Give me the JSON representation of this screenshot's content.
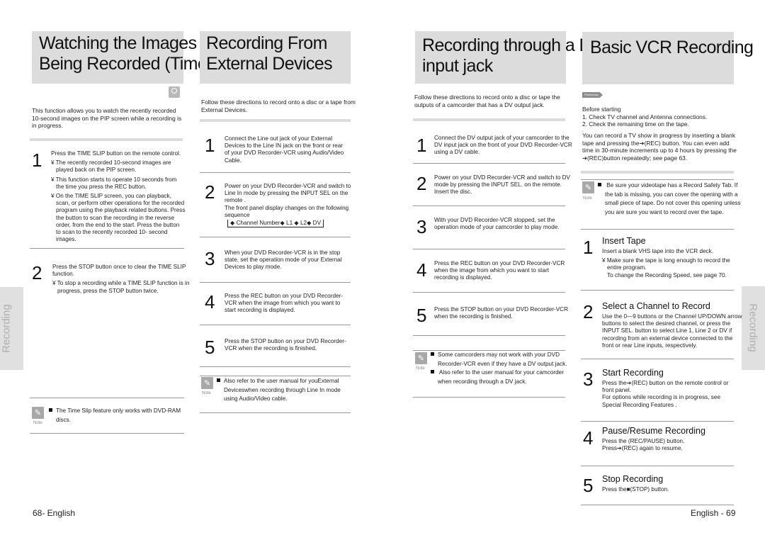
{
  "side_tab_label": "Recording",
  "sections": {
    "timeslip": {
      "title": "Watching the Images\nBeing Recorded (Time Slip)",
      "badge_icon": "dvd-ram-disc-icon",
      "intro": "This function allows you to watch the recently recorded 10-second images on the PIP screen while a recording is in progress.",
      "steps": [
        {
          "num": "1",
          "text": "Press the TIME SLIP button on the remote control.",
          "bullets": [
            "¥ The recently recorded 10-second images are played back on the PIP screen.",
            "¥ This function starts to operate 10 seconds from the time you press the REC button.",
            "¥ On the TIME SLIP screen, you can playback, scan, or perform other operations for the recorded program using the playback related buttons. Press the     button to scan the recording in the reverse order, from the end to the start. Press the     button to scan to the recently recorded  10- second images."
          ]
        },
        {
          "num": "2",
          "text": "Press the STOP button once to clear the TIME SLIP function.",
          "bullets": [
            "¥ To stop a recording while a TIME SLIP function is in progress, press the STOP button twice."
          ]
        }
      ],
      "note_label": "Note",
      "notes": [
        "The Time Slip feature only works with DVD-RAM discs."
      ]
    },
    "external": {
      "title": "Recording From\nExternal Devices",
      "intro": "Follow these directions to record onto a disc or a tape from External Devices.",
      "steps": [
        {
          "num": "1",
          "text": "Connect the Line out jack of your External Devices to the Line IN jack on the front or rear of your DVD Recorder-VCR using Audio/Video Cable."
        },
        {
          "num": "2",
          "text": "Power on your DVD Recorder-VCR and switch to Line In mode by pressing the INPUT SEL on the remote .",
          "text2": "The front panel display changes on the following sequence",
          "sequence": "◆ Channel Number◆  L1 ◆  L2◆  DV"
        },
        {
          "num": "3",
          "text": "When your DVD Recorder-VCR is in the stop state, set the operation mode of your External Devices to play mode."
        },
        {
          "num": "4",
          "text": "Press the REC button on your DVD Recorder-VCR when the image from which you want to start recording is displayed."
        },
        {
          "num": "5",
          "text": "Press the STOP button on your DVD Recorder-VCR when the recording is finished."
        }
      ],
      "note_label": "Note",
      "notes": [
        "Also refer to the user manual for youExternal Deviceswhen recording through Line In mode using Audio/Video cable."
      ]
    },
    "dv": {
      "title": "Recording through a DV\ninput jack",
      "intro": "Follow these directions to record onto a disc or tape the outputs of a camcorder that has a DV output jack.",
      "steps": [
        {
          "num": "1",
          "text": "Connect the DV output jack of your camcorder to the DV input jack on the front of your DVD Recorder-VCR using a DV cable."
        },
        {
          "num": "2",
          "text": "Power on your DVD Recorder-VCR and switch to DV mode by pressing the INPUT SEL. on the remote. Insert the disc."
        },
        {
          "num": "3",
          "text": "With your DVD Recorder-VCR stopped, set the operation mode of your camcorder to play mode."
        },
        {
          "num": "4",
          "text": "Press the REC button on your DVD Recorder-VCR when the image from which you want to start recording is displayed."
        },
        {
          "num": "5",
          "text": "Press the STOP button on your DVD Recorder-VCR when the recording is finished."
        }
      ],
      "note_label": "Note",
      "notes": [
        "Some camcorders may not work with your DVD Recorder-VCR even if they have a DV output jack.",
        " Also refer to the user manual for your   camcorder when recording through a DV jack."
      ]
    },
    "vcr": {
      "title": "Basic VCR Recording",
      "prelim_badge": "Preliminary",
      "before_lines": [
        "Before starting",
        "1. Check TV channel and Antenna connections.",
        "2. Check the remaining time on the tape."
      ],
      "intro": "You can record a TV show in progress by inserting a blank tape and pressing the➔(REC) button. You can even add time in 30-minute increments up to 4 hours by pressing the ➔(REC)button repeatedly; see page 63.",
      "note_label": "Note",
      "notes": [
        " Be sure your videotape has a Record Safety Tab. If the tab is missing, you can cover the opening with a small piece of tape. Do not cover this opening unless you are sure you want to record over the tape."
      ],
      "steps": [
        {
          "num": "1",
          "title": "Insert Tape",
          "lines": [
            "Insert a blank VHS tape into the VCR deck."
          ],
          "bullets": [
            "¥ Make sure the tape is long enough to record the entire program.",
            "To change the Recording Speed, see page 70."
          ]
        },
        {
          "num": "2",
          "title": "Select a Channel to Record",
          "lines": [
            "Use the 0—9 buttons or the Channel UP/DOWN arrow buttons to select the desired channel, or press the INPUT SEL. button to select Line 1, Line 2 or DV if recording from an external device connected to the front or rear Line inputs, respectively."
          ]
        },
        {
          "num": "3",
          "title": "Start Recording",
          "lines": [
            "Press the➔(REC) button on the remote control or front panel.",
            "For options while recording is in progress, see  Special Recording Features ."
          ]
        },
        {
          "num": "4",
          "title": "Pause/Resume Recording",
          "lines": [
            "Press the   (REC/PAUSE) button.",
            "Press➔(REC) again to resume."
          ]
        },
        {
          "num": "5",
          "title": "Stop Recording",
          "lines": [
            "Press the■(STOP) button."
          ]
        }
      ]
    }
  },
  "footer": {
    "left": "68- English",
    "right": "English - 69"
  }
}
